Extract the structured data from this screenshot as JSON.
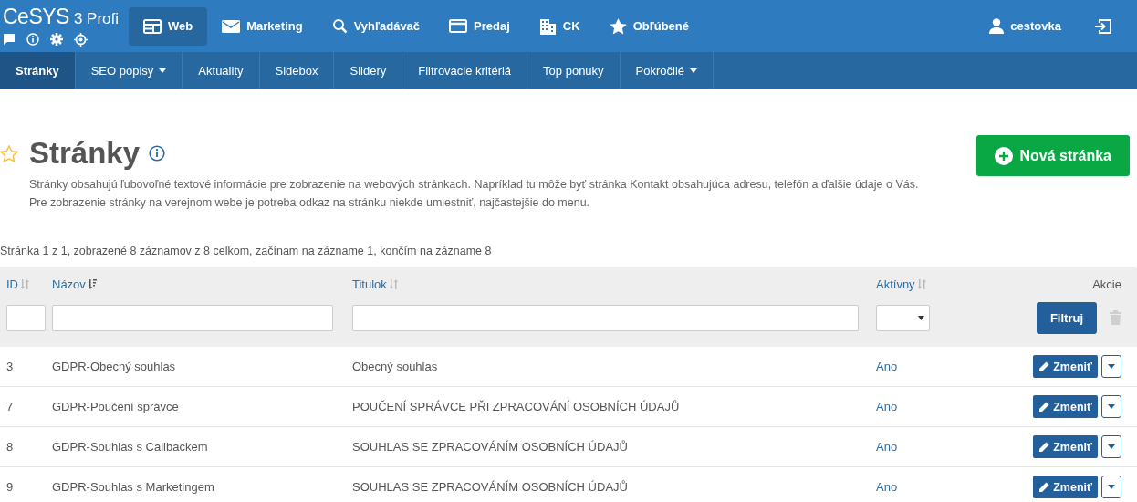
{
  "brand": {
    "name": "CeSYS",
    "edition": "3 Profi"
  },
  "main_nav": [
    {
      "label": "Web",
      "selected": true
    },
    {
      "label": "Marketing",
      "selected": false
    },
    {
      "label": "Vyhľadávač",
      "selected": false
    },
    {
      "label": "Predaj",
      "selected": false
    },
    {
      "label": "CK",
      "selected": false
    },
    {
      "label": "Obľúbené",
      "selected": false
    }
  ],
  "user": {
    "name": "cestovka"
  },
  "sub_nav": [
    {
      "label": "Stránky",
      "selected": true,
      "dropdown": false
    },
    {
      "label": "SEO popisy",
      "selected": false,
      "dropdown": true
    },
    {
      "label": "Aktuality",
      "selected": false,
      "dropdown": false
    },
    {
      "label": "Sidebox",
      "selected": false,
      "dropdown": false
    },
    {
      "label": "Slidery",
      "selected": false,
      "dropdown": false
    },
    {
      "label": "Filtrovacie kritériá",
      "selected": false,
      "dropdown": false
    },
    {
      "label": "Top ponuky",
      "selected": false,
      "dropdown": false
    },
    {
      "label": "Pokročilé",
      "selected": false,
      "dropdown": true
    }
  ],
  "page": {
    "title": "Stránky",
    "favorite": false,
    "description": "Stránky obsahujú ľubovoľné textové informácie pre zobrazenie na webových stránkach. Napríklad tu môže byť stránka Kontakt obsahujúca adresu, telefón a ďalšie údaje o Vás. Pre zobrazenie stránky na verejnom webe je potreba odkaz na stránku niekde umiestniť, najčastejšie do menu.",
    "new_button": "Nová stránka"
  },
  "table": {
    "summary": "Stránka 1 z 1, zobrazené 8 záznamov z 8 celkom, začínam na zázname 1, končím na zázname 8",
    "columns": [
      {
        "label": "ID",
        "kind": "text",
        "sorted": false
      },
      {
        "label": "Názov",
        "kind": "text",
        "sorted": true
      },
      {
        "label": "Titulok",
        "kind": "text",
        "sorted": false
      },
      {
        "label": "Aktívny",
        "kind": "select",
        "sorted": false
      },
      {
        "label": "Akcie",
        "kind": "actions"
      }
    ],
    "filter_button": "Filtruj",
    "rows": [
      {
        "id": "3",
        "name": "GDPR-Obecný souhlas",
        "title": "Obecný souhlas",
        "active": "Ano",
        "action": "Zmeniť"
      },
      {
        "id": "7",
        "name": "GDPR-Poučení správce",
        "title": "POUČENÍ SPRÁVCE PŘI ZPRACOVÁNÍ OSOBNÍCH ÚDAJŮ",
        "active": "Ano",
        "action": "Zmeniť"
      },
      {
        "id": "8",
        "name": "GDPR-Souhlas s Callbackem",
        "title": "SOUHLAS SE ZPRACOVÁNÍM OSOBNÍCH ÚDAJŮ",
        "active": "Ano",
        "action": "Zmeniť"
      },
      {
        "id": "9",
        "name": "GDPR-Souhlas s Marketingem",
        "title": "SOUHLAS SE ZPRACOVÁNÍM OSOBNÍCH ÚDAJŮ",
        "active": "Ano",
        "action": "Zmeniť"
      }
    ]
  }
}
